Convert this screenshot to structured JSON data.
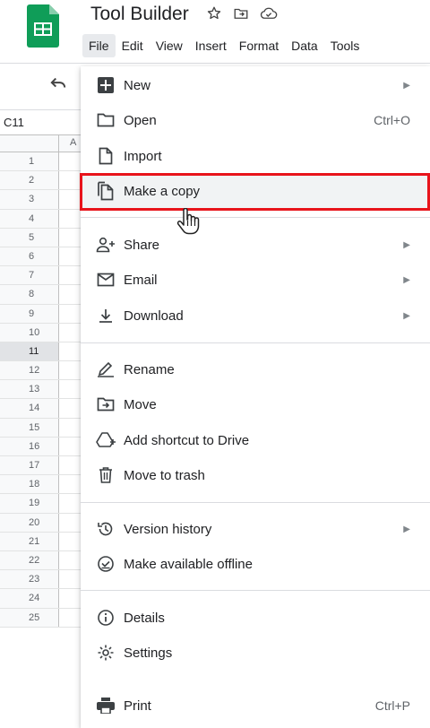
{
  "doc": {
    "title": "Tool Builder"
  },
  "menubar": {
    "items": [
      "File",
      "Edit",
      "View",
      "Insert",
      "Format",
      "Data",
      "Tools"
    ],
    "active": "File"
  },
  "sheet": {
    "cell_ref": "C11",
    "column_a": "A",
    "rows": [
      "1",
      "2",
      "3",
      "4",
      "5",
      "6",
      "7",
      "8",
      "9",
      "10",
      "11",
      "12",
      "13",
      "14",
      "15",
      "16",
      "17",
      "18",
      "19",
      "20",
      "21",
      "22",
      "23",
      "24",
      "25"
    ],
    "selected_row": "11"
  },
  "file_menu": {
    "new": {
      "label": "New",
      "icon": "new-sheet-icon"
    },
    "open": {
      "label": "Open",
      "shortcut": "Ctrl+O",
      "icon": "folder-icon"
    },
    "import": {
      "label": "Import",
      "icon": "file-icon"
    },
    "copy": {
      "label": "Make a copy",
      "icon": "copy-icon"
    },
    "share": {
      "label": "Share",
      "icon": "person-add-icon"
    },
    "email": {
      "label": "Email",
      "icon": "envelope-icon"
    },
    "download": {
      "label": "Download",
      "icon": "download-icon"
    },
    "rename": {
      "label": "Rename",
      "icon": "pencil-icon"
    },
    "move": {
      "label": "Move",
      "icon": "move-folder-icon"
    },
    "shortcut": {
      "label": "Add shortcut to Drive",
      "icon": "drive-shortcut-icon"
    },
    "trash": {
      "label": "Move to trash",
      "icon": "trash-icon"
    },
    "version": {
      "label": "Version history",
      "icon": "history-icon"
    },
    "offline": {
      "label": "Make available offline",
      "icon": "offline-icon"
    },
    "details": {
      "label": "Details",
      "icon": "info-icon"
    },
    "settings": {
      "label": "Settings",
      "icon": "gear-icon"
    },
    "print": {
      "label": "Print",
      "shortcut": "Ctrl+P",
      "icon": "printer-icon"
    }
  },
  "colors": {
    "brand_green": "#0f9d58",
    "callout_red": "#e8141b",
    "hover_bg": "#f1f3f4"
  }
}
